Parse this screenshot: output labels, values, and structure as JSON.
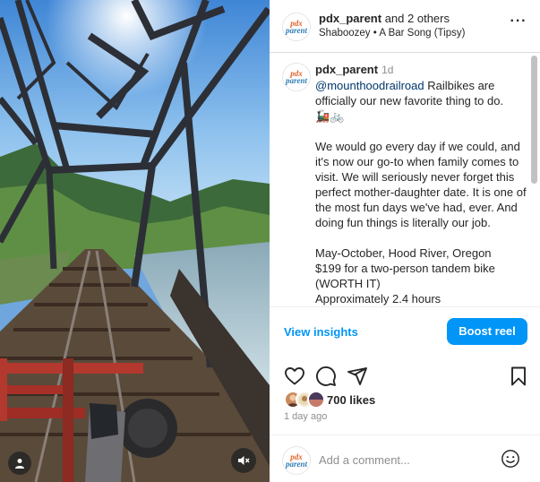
{
  "header": {
    "username": "pdx_parent",
    "coauthors": "and 2 others",
    "audio_artist": "Shaboozey",
    "audio_separator": "•",
    "audio_track": "A Bar Song (Tipsy)",
    "more_icon": "more-horizontal-icon",
    "more_label": "···"
  },
  "logo": {
    "line1": "pdx",
    "line2": "parent"
  },
  "caption": {
    "username": "pdx_parent",
    "time": "1d",
    "mention": "@mounthoodrailroad",
    "intro": " Railbikes are officially our new favorite thing to do.",
    "emojis": "🚂🚲",
    "paragraph2": "We would go every day if we could, and it's now our go-to when family comes to visit. We will seriously never forget this perfect mother-daughter date. It is one of the most fun days we've had, ever. And doing fun things is literally our job.",
    "details": [
      "May-October, Hood River, Oregon",
      "$199 for a two-person tandem bike (WORTH IT)",
      "Approximately 2.4 hours"
    ]
  },
  "actions": {
    "view_insights": "View insights",
    "boost_reel": "Boost reel",
    "like_icon": "heart-icon",
    "comment_icon": "comment-icon",
    "share_icon": "share-icon",
    "save_icon": "bookmark-icon"
  },
  "likes": {
    "count_text": "700 likes"
  },
  "time_ago": "1 day ago",
  "comment": {
    "placeholder": "Add a comment...",
    "emoji_icon": "emoji-icon"
  },
  "media": {
    "user_tag_icon": "person-icon",
    "mute_icon": "speaker-muted-icon"
  },
  "colors": {
    "accent": "#0095f6",
    "text": "#262626",
    "secondary": "#8e8e8e",
    "mention": "#00376b"
  }
}
